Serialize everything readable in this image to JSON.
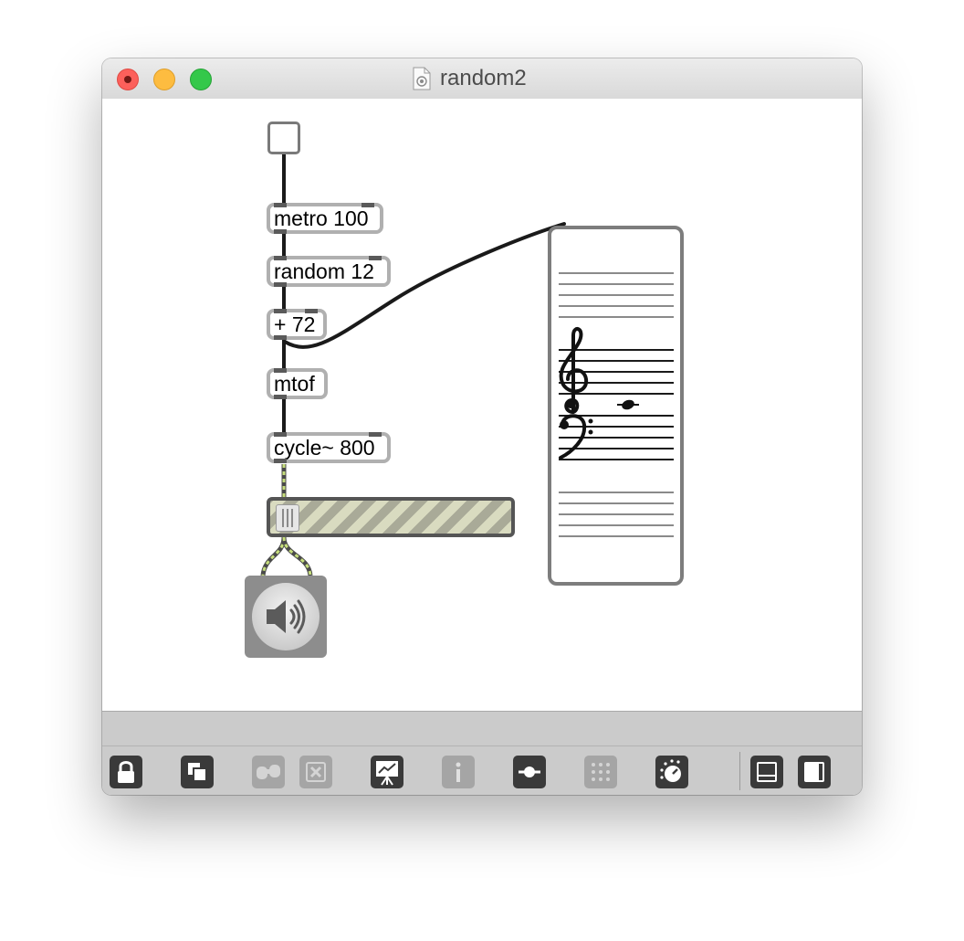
{
  "window": {
    "title": "random2"
  },
  "patch": {
    "toggle": {
      "state": "off"
    },
    "objects": {
      "metro": "metro 100",
      "random": "random 12",
      "plus": "+ 72",
      "mtof": "mtof",
      "cycle": "cycle~ 800"
    },
    "meter": {
      "level": 0.0
    },
    "dac": {
      "icon": "speaker-icon"
    },
    "staff": {
      "clefs": [
        "treble-clef-icon",
        "bass-clef-icon"
      ],
      "note": "whole-note-icon"
    }
  },
  "toolbar": {
    "buttons": [
      {
        "icon": "lock-icon",
        "enabled": true
      },
      {
        "icon": "presentation-layers-icon",
        "enabled": true
      },
      {
        "icon": "binoculars-icon",
        "enabled": false
      },
      {
        "icon": "close-box-icon",
        "enabled": false
      },
      {
        "icon": "easel-presentation-icon",
        "enabled": true
      },
      {
        "icon": "info-icon",
        "enabled": false
      },
      {
        "icon": "slider-icon",
        "enabled": true
      },
      {
        "icon": "grid-icon",
        "enabled": false
      },
      {
        "icon": "dial-icon",
        "enabled": true
      },
      {
        "icon": "bottom-panel-icon",
        "enabled": true
      },
      {
        "icon": "right-panel-icon",
        "enabled": true
      }
    ]
  }
}
